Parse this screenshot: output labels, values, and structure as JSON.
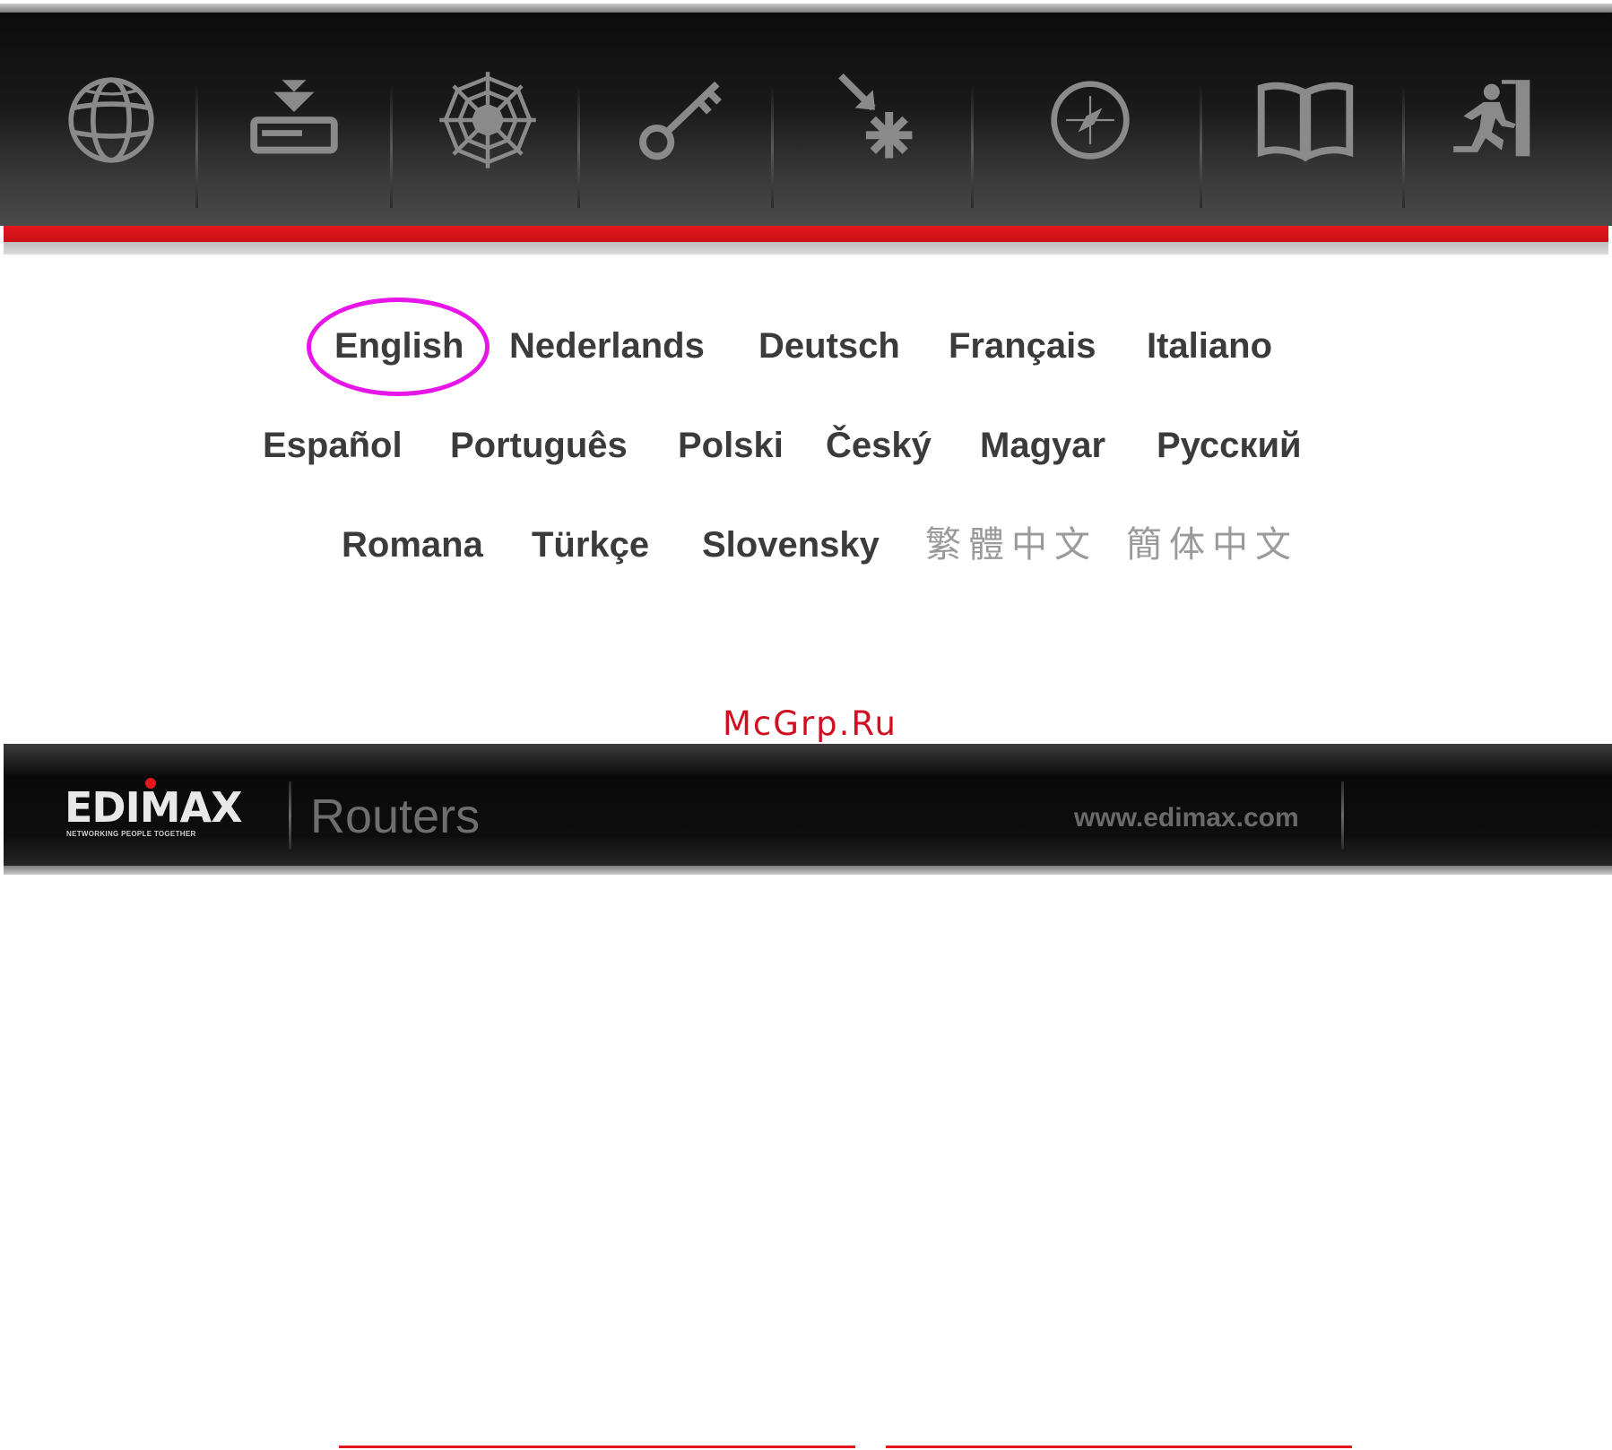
{
  "toolbar": {
    "icons": [
      "globe-icon",
      "install-icon",
      "web-icon",
      "key-icon",
      "setup-icon",
      "compass-icon",
      "manual-icon",
      "exit-icon"
    ]
  },
  "languages": {
    "row1": [
      "English",
      "Nederlands",
      "Deutsch",
      "Français",
      "Italiano"
    ],
    "row2": [
      "Español",
      "Português",
      "Polski",
      "Český",
      "Magyar",
      "Русский"
    ],
    "row3": [
      "Romana",
      "Türkçe",
      "Slovensky",
      "繁體中文",
      "簡体中文"
    ],
    "selected": "English"
  },
  "watermark": "McGrp.Ru",
  "footer": {
    "logo": "EDIMAX",
    "tagline": "NETWORKING PEOPLE TOGETHER",
    "product": "Routers",
    "website": "www.edimax.com"
  },
  "colors": {
    "accent_red": "#e5171d",
    "highlight": "#e815e8",
    "toolbar_bg": "#111111",
    "icon_grey": "#8a8a8a"
  }
}
